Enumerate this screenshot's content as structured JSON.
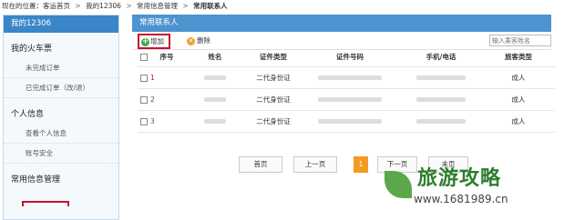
{
  "breadcrumb": {
    "prefix": "现在的位置：客运首页",
    "items": [
      "我的12306",
      "常用信息管理",
      "常用联系人"
    ],
    "separator": ">"
  },
  "sidebar": {
    "title": "我的12306",
    "groups": [
      {
        "label": "我的火车票",
        "items": [
          "未完成订单",
          "已完成订单（改/退）"
        ]
      },
      {
        "label": "个人信息",
        "items": [
          "查看个人信息",
          "账号安全"
        ]
      },
      {
        "label": "常用信息管理",
        "items": []
      }
    ]
  },
  "panel": {
    "title": "常用联系人",
    "add_label": "增加",
    "delete_label": "删除",
    "search_placeholder": "输入乘客姓名"
  },
  "table": {
    "headers": [
      "序号",
      "姓名",
      "证件类型",
      "证件号码",
      "手机/电话",
      "旅客类型"
    ],
    "rows": [
      {
        "seq": "1",
        "id_type": "二代身份证",
        "passenger_type": "成人"
      },
      {
        "seq": "2",
        "id_type": "二代身份证",
        "passenger_type": "成人"
      },
      {
        "seq": "3",
        "id_type": "二代身份证",
        "passenger_type": "成人"
      }
    ]
  },
  "pager": {
    "first": "首页",
    "prev": "上一页",
    "current": "1",
    "next": "下一页",
    "last": "末页"
  },
  "watermark": {
    "title": "旅游攻略",
    "url": "www.1681989.cn"
  },
  "colors": {
    "accent_blue": "#4d93cf",
    "highlight_red": "#c8102e",
    "active_orange": "#f39a22"
  }
}
